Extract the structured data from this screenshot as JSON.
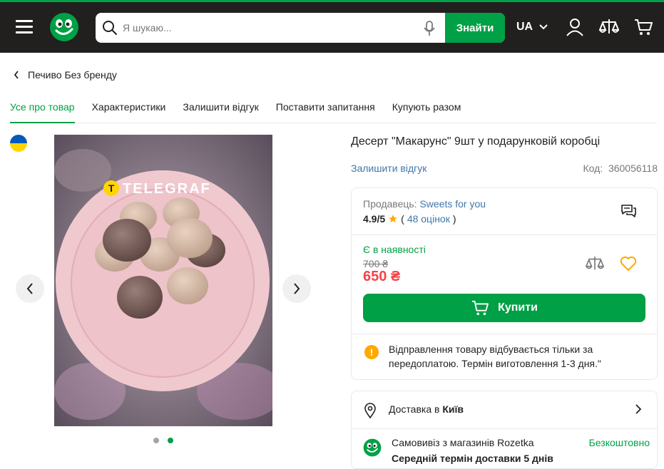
{
  "header": {
    "search_placeholder": "Я шукаю...",
    "search_button": "Знайти",
    "language": "UA"
  },
  "breadcrumb": {
    "back_label": "Печиво Без бренду"
  },
  "tabs": [
    {
      "label": "Усе про товар",
      "active": true
    },
    {
      "label": "Характеристики"
    },
    {
      "label": "Залишити відгук"
    },
    {
      "label": "Поставити запитання"
    },
    {
      "label": "Купують разом"
    }
  ],
  "gallery": {
    "watermark": "TELEGRAF",
    "slides": 2,
    "current": 2
  },
  "product": {
    "title": "Десерт \"Макарунс\" 9шт у подарунковій коробці",
    "review_link": "Залишити відгук",
    "code_label": "Код:",
    "code_value": "360056118"
  },
  "seller": {
    "label": "Продавець:",
    "name": "Sweets for you",
    "rating": "4.9/5",
    "reviews_open": "(",
    "reviews_count": "48 оцінок",
    "reviews_close": ")"
  },
  "offer": {
    "availability": "Є в наявності",
    "old_price": "700 ₴",
    "price": "650 ₴",
    "buy_button": "Купити",
    "notice": "Відправлення товару відбувається тільки за передоплатою. Термін виготовлення 1-3 дня.\""
  },
  "delivery": {
    "label": "Доставка в",
    "city": "Київ",
    "pickup": "Самовивіз з магазинів Rozetka",
    "pickup_price": "Безкоштовно",
    "term": "Середній термін доставки 5 днів"
  },
  "colors": {
    "accent": "#00a046",
    "price": "#f84147",
    "link": "#3e77aa",
    "header": "#221f1f"
  }
}
